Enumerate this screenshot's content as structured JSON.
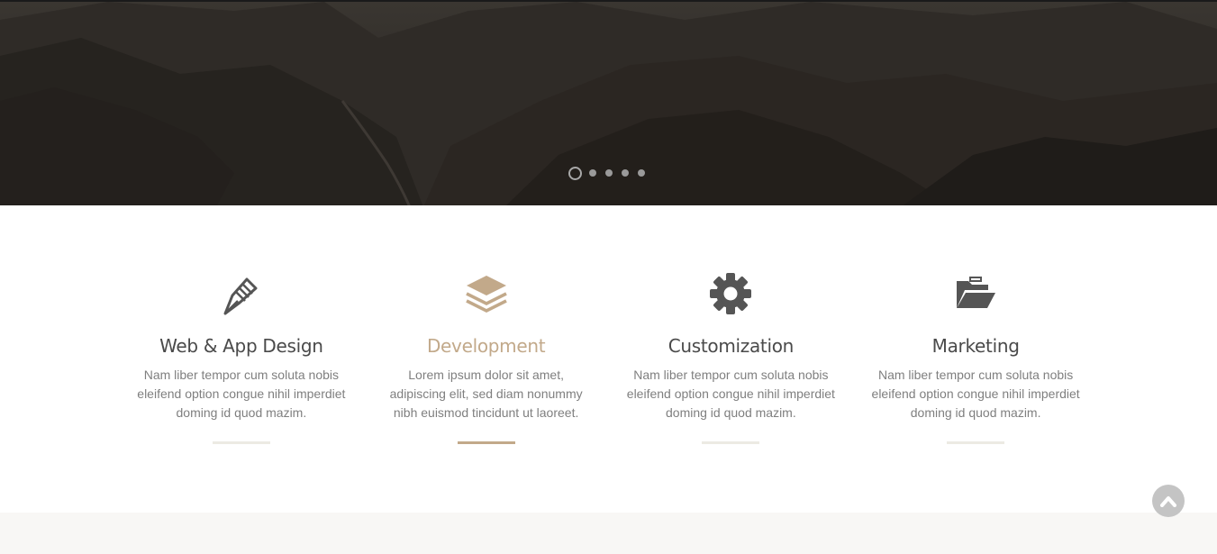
{
  "hero": {
    "slides_count": 5,
    "active_slide": 1
  },
  "services": [
    {
      "icon": "pen-nib-icon",
      "title": "Web & App Design",
      "description": "Nam liber tempor cum soluta nobis eleifend option congue nihil imperdiet doming id quod mazim.",
      "active": false
    },
    {
      "icon": "layers-icon",
      "title": "Development",
      "description": "Lorem ipsum dolor sit amet, adipiscing elit, sed diam nonummy nibh euismod tincidunt ut laoreet.",
      "active": true
    },
    {
      "icon": "gear-icon",
      "title": "Customization",
      "description": "Nam liber tempor cum soluta nobis eleifend option congue nihil imperdiet doming id quod mazim.",
      "active": false
    },
    {
      "icon": "folder-open-icon",
      "title": "Marketing",
      "description": "Nam liber tempor cum soluta nobis eleifend option congue nihil imperdiet doming id quod mazim.",
      "active": false
    }
  ],
  "back_to_top": {
    "icon": "chevron-up-icon"
  },
  "colors": {
    "accent": "#c2a98a",
    "title": "#4a4a4a",
    "text": "#7f7f7f",
    "icon": "#555555",
    "divider": "#eceae3"
  }
}
